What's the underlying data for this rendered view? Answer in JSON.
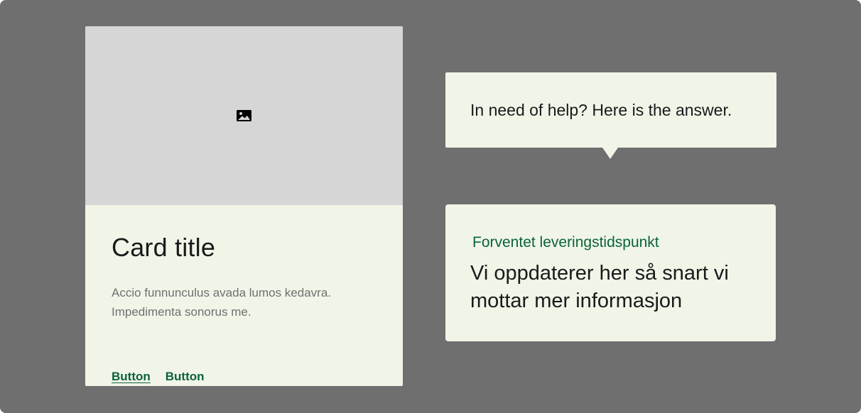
{
  "card": {
    "image_icon": "image-icon",
    "title": "Card title",
    "description": "Accio funnunculus avada lumos kedavra. Impedimenta sonorus me.",
    "buttons": [
      {
        "label": "Button",
        "underlined": true
      },
      {
        "label": "Button",
        "underlined": false
      }
    ]
  },
  "tooltip": {
    "text": "In need of help? Here is the answer."
  },
  "info_panel": {
    "label": "Forventet leveringstidspunkt",
    "value": "Vi oppdaterer her så snart vi mottar mer informasjon"
  },
  "colors": {
    "background": "#6f6f6f",
    "surface": "#f0f5e8",
    "media_placeholder": "#d6d6d6",
    "accent_green": "#0b6338",
    "muted_text": "#707070",
    "primary_text": "#1a1a1a"
  }
}
